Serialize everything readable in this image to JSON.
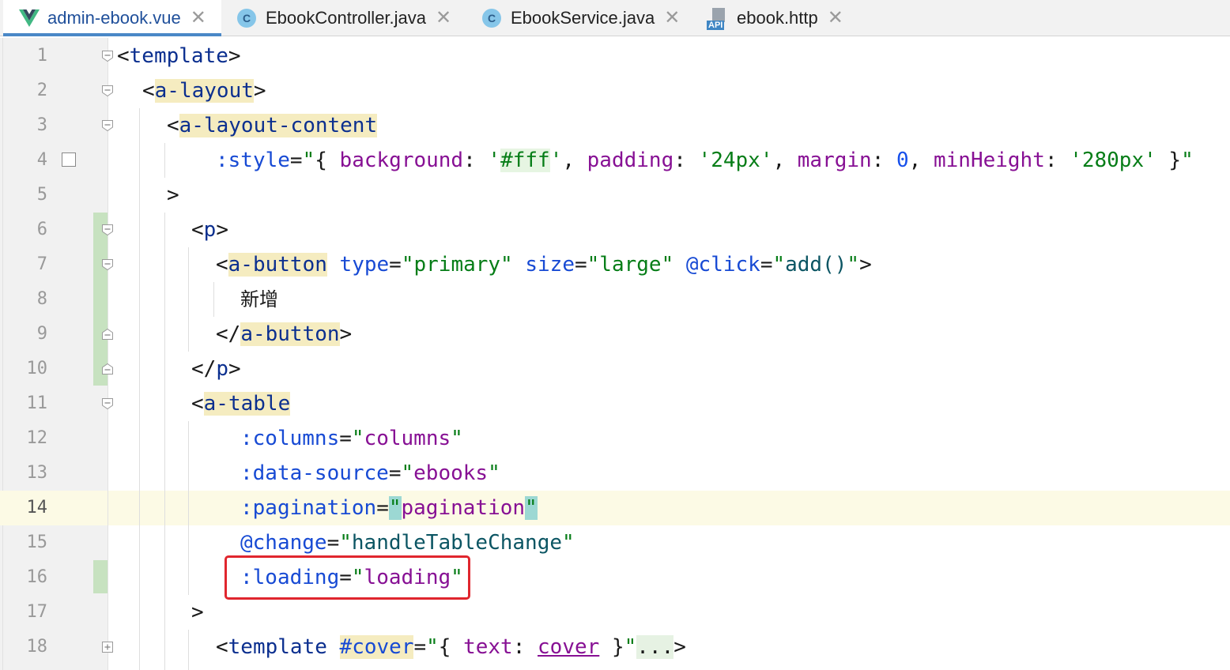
{
  "tabs": [
    {
      "label": "admin-ebook.vue",
      "icon": "vue-icon",
      "active": true
    },
    {
      "label": "EbookController.java",
      "icon": "class-c-icon",
      "active": false
    },
    {
      "label": "EbookService.java",
      "icon": "class-c-icon",
      "active": false
    },
    {
      "label": "ebook.http",
      "icon": "api-file-icon",
      "active": false
    }
  ],
  "tab_close_glyph": "✕",
  "api_icon_label": "API",
  "class_icon_letter": "C",
  "line_numbers": [
    "1",
    "2",
    "3",
    "4",
    "5",
    "6",
    "7",
    "8",
    "9",
    "10",
    "11",
    "12",
    "13",
    "14",
    "15",
    "16",
    "17",
    "18"
  ],
  "current_line": "14",
  "code": {
    "l1": {
      "open": "<",
      "tag": "template",
      "close": ">"
    },
    "l2": {
      "open": "<",
      "tag": "a-layout",
      "close": ">"
    },
    "l3": {
      "open": "<",
      "tag": "a-layout-content"
    },
    "l4": {
      "attr": ":style",
      "eq": "=",
      "q1": "\"",
      "brace_open": "{ ",
      "k1": "background",
      "c1": ": ",
      "v1a": "'",
      "v1": "#fff",
      "v1b": "'",
      "s1": ", ",
      "k2": "padding",
      "c2": ": ",
      "v2": "'24px'",
      "s2": ", ",
      "k3": "margin",
      "c3": ": ",
      "v3": "0",
      "s3": ", ",
      "k4": "minHeight",
      "c4": ": ",
      "v4": "'280px'",
      "brace_close": " }",
      "q2": "\""
    },
    "l5": {
      "close": ">"
    },
    "l6": {
      "open": "<",
      "tag": "p",
      "close": ">"
    },
    "l7": {
      "open": "<",
      "tag": "a-button",
      "sp": " ",
      "a1": "type",
      "e1": "=",
      "v1": "\"primary\"",
      "sp2": " ",
      "a2": "size",
      "e2": "=",
      "v2": "\"large\"",
      "sp3": " ",
      "a3": "@click",
      "e3": "=",
      "q1": "\"",
      "v3": "add()",
      "q2": "\"",
      "close": ">"
    },
    "l8": {
      "text": "新增"
    },
    "l9": {
      "open": "</",
      "tag": "a-button",
      "close": ">"
    },
    "l10": {
      "open": "</",
      "tag": "p",
      "close": ">"
    },
    "l11": {
      "open": "<",
      "tag": "a-table"
    },
    "l12": {
      "attr": ":columns",
      "eq": "=",
      "q1": "\"",
      "val": "columns",
      "q2": "\""
    },
    "l13": {
      "attr": ":data-source",
      "eq": "=",
      "q1": "\"",
      "val": "ebooks",
      "q2": "\""
    },
    "l14": {
      "attr": ":pagination",
      "eq": "=",
      "q1": "\"",
      "val": "pagination",
      "q2": "\""
    },
    "l15": {
      "attr": "@change",
      "eq": "=",
      "q1": "\"",
      "val": "handleTableChange",
      "q2": "\""
    },
    "l16": {
      "attr": ":loading",
      "eq": "=",
      "q1": "\"",
      "val": "loading",
      "q2": "\""
    },
    "l17": {
      "close": ">"
    },
    "l18": {
      "open": "<",
      "tag": "template",
      "sp": " ",
      "attr": "#cover",
      "eq": "=",
      "q1": "\"",
      "b1": "{ ",
      "k": "text",
      "c": ": ",
      "v": "cover",
      "b2": " }",
      "q2": "\"",
      "ell": "...",
      "close": ">"
    }
  }
}
